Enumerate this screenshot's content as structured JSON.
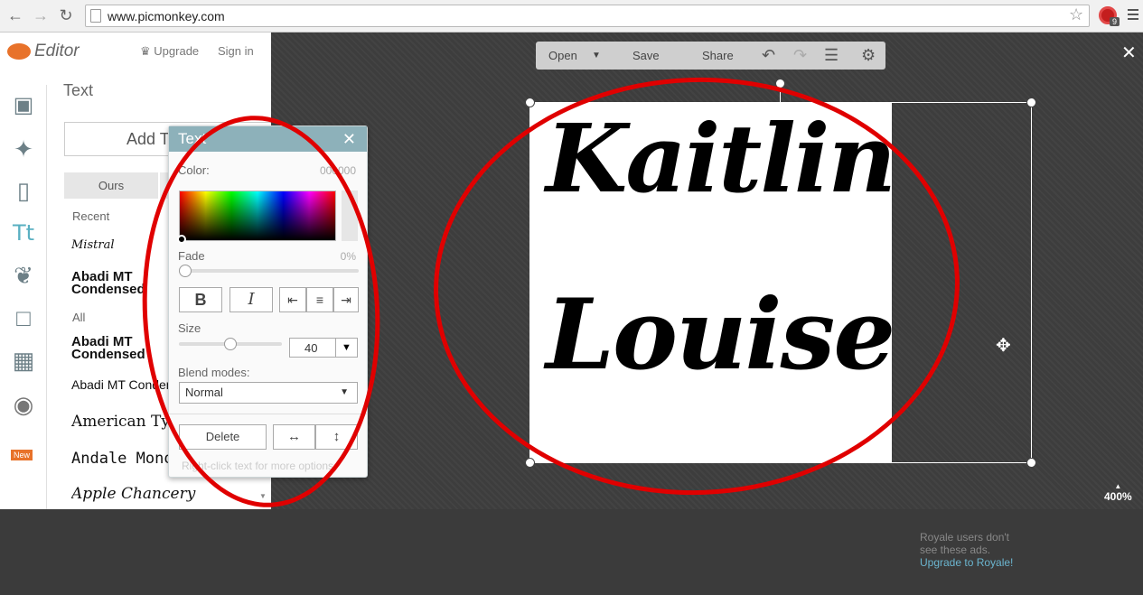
{
  "browser": {
    "url": "www.picmonkey.com",
    "ext_badge": "9"
  },
  "app": {
    "logo_text": "Editor",
    "nav": {
      "upgrade": "Upgrade",
      "sign_in": "Sign in"
    },
    "tools": [
      "crop-icon",
      "magic-wand-icon",
      "lipstick-icon",
      "text-icon",
      "butterfly-icon",
      "frame-icon",
      "texture-icon",
      "pumpkin-icon"
    ],
    "new_badge": "New"
  },
  "text_panel": {
    "title": "Text",
    "add_text_button": "Add Text",
    "tabs": {
      "ours": "Ours"
    },
    "recent_header": "Recent",
    "recent_fonts": [
      "Mistral",
      "Abadi MT Condensed Extra Bold"
    ],
    "all_header": "All",
    "all_fonts": [
      "Abadi MT Condensed Extra Bold",
      "Abadi MT Condensed",
      "American Typewriter",
      "Andale Mono",
      "Apple Chancery"
    ]
  },
  "text_dialog": {
    "title": "Text",
    "color_label": "Color:",
    "color_value": "000000",
    "fade_label": "Fade",
    "fade_value": "0%",
    "fade_level": 0,
    "bold": "B",
    "italic": "I",
    "size_label": "Size",
    "size_value": "40",
    "size_level": 0.5,
    "blend_label": "Blend modes:",
    "blend_value": "Normal",
    "delete_button": "Delete",
    "hint": "Right-click text for more options."
  },
  "editor_toolbar": {
    "open": "Open",
    "save": "Save",
    "share": "Share"
  },
  "canvas": {
    "line1": "Kaitlin",
    "line2": "Louise",
    "zoom": "400%"
  },
  "ad": {
    "line1": "Royale users don't",
    "line2": "see these ads.",
    "link": "Upgrade to Royale!"
  },
  "colors": {
    "annotation": "#e00000",
    "accent": "#8db1ba",
    "text_tool_active": "#5ab0c2"
  }
}
